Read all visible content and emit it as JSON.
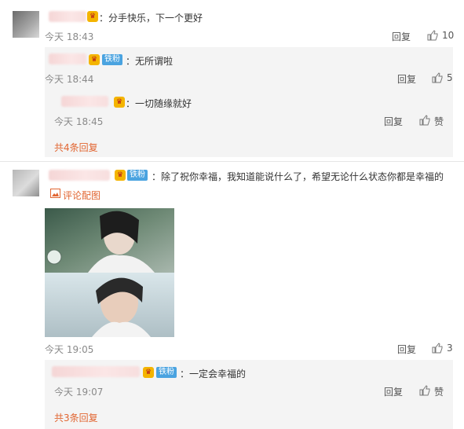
{
  "colors": {
    "accent": "#e16531",
    "badge": "#4aa3e0",
    "reply_bg": "#f4f4f4",
    "crown": "#f4b400"
  },
  "comments": [
    {
      "text": "：分手快乐，下一个更好",
      "time": "今天 18:43",
      "reply_label": "回复",
      "likes": "10",
      "replies": [
        {
          "badge": "铁粉",
          "text": "：无所谓啦",
          "time": "今天 18:44",
          "reply_label": "回复",
          "likes": "5"
        },
        {
          "text": "：一切随缘就好",
          "time": "今天 18:45",
          "reply_label": "回复",
          "likes": "赞"
        }
      ],
      "more_replies": "共4条回复"
    },
    {
      "badge": "铁粉",
      "text": "：除了祝你幸福，我知道能说什么了，希望无论什么状态你都是幸福的",
      "image_link": "评论配图",
      "time": "今天 19:05",
      "reply_label": "回复",
      "likes": "3",
      "replies": [
        {
          "badge": "铁粉",
          "text": "：一定会幸福的",
          "time": "今天 19:07",
          "reply_label": "回复",
          "likes": "赞"
        }
      ],
      "more_replies": "共3条回复"
    }
  ],
  "icons": {
    "like": "thumbs-up-icon",
    "crown": "crown-icon",
    "image": "image-icon",
    "avatar": "avatar"
  }
}
